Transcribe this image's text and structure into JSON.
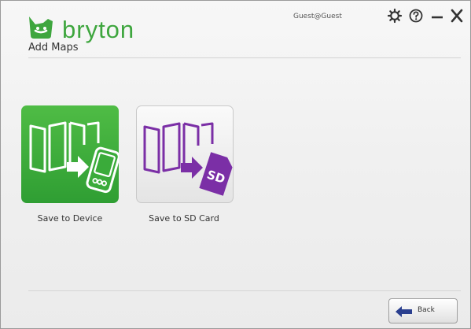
{
  "app": {
    "brand_name": "bryton",
    "page_title": "Add Maps",
    "user": "Guest@Guest"
  },
  "window_controls": [
    {
      "name": "settings",
      "icon": "gear-icon"
    },
    {
      "name": "help",
      "icon": "help-icon"
    },
    {
      "name": "minimize",
      "icon": "minimize-icon"
    },
    {
      "name": "close",
      "icon": "close-icon"
    }
  ],
  "options": [
    {
      "id": "device",
      "label": "Save to Device",
      "icon": "map-to-device-icon",
      "color": "#3aab3a"
    },
    {
      "id": "sd",
      "label": "Save to SD Card",
      "icon": "map-to-sd-card-icon",
      "color": "#7b2fa6"
    }
  ],
  "footer": {
    "back_label": "Back",
    "back_icon": "arrow-left-icon"
  },
  "colors": {
    "brand": "#3ea63e",
    "sd_accent": "#7b2fa6",
    "back_arrow": "#2a3f8f"
  }
}
